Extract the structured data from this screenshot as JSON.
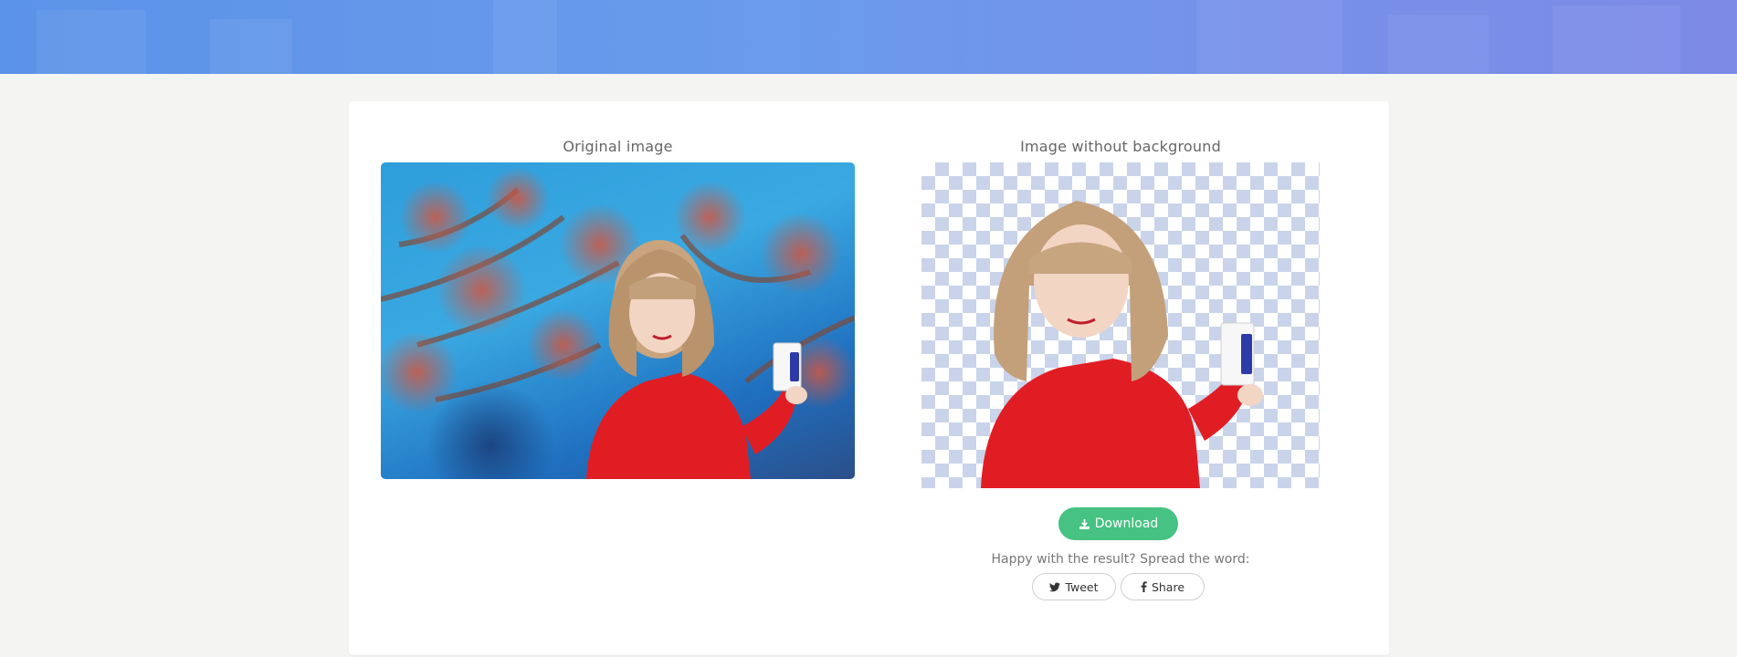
{
  "original": {
    "title": "Original image"
  },
  "result": {
    "title": "Image without background",
    "download_label": "Download"
  },
  "share": {
    "prompt": "Happy with the result? Spread the word:",
    "tweet_label": "Tweet",
    "share_label": "Share"
  },
  "colors": {
    "header_start": "#5b93e8",
    "header_end": "#7d8ae6",
    "download_bg": "#46c282",
    "checker": "#c9d4ea"
  },
  "icons": {
    "download": "download-icon",
    "tweet": "twitter-icon",
    "share": "facebook-icon"
  }
}
